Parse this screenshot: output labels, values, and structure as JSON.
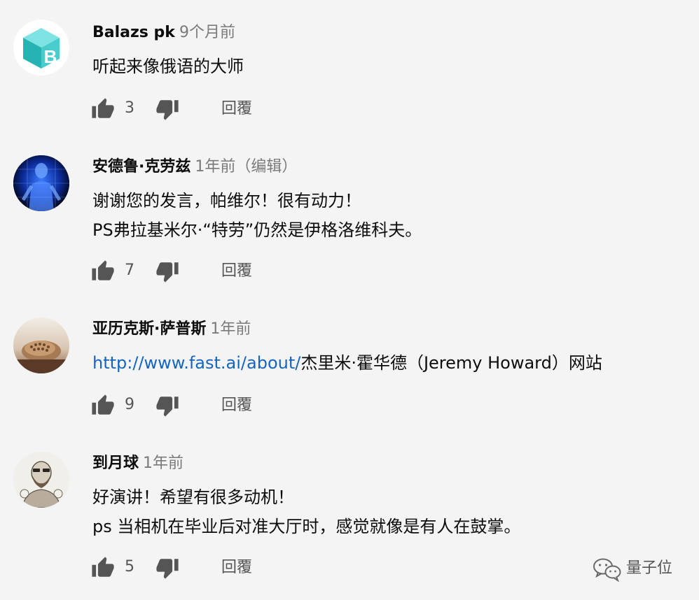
{
  "comments": [
    {
      "author": "Balazs pk",
      "time": "9个月前",
      "edited": "",
      "lines": [
        "听起来像俄语的大师"
      ],
      "likes": "3",
      "reply": "回覆",
      "avatar_icon": "letter-b-cube-avatar",
      "avatar_letter": "B"
    },
    {
      "author": "安德鲁·克劳兹",
      "time": "1年前",
      "edited": "（编辑）",
      "lines": [
        "谢谢您的发言，帕维尔！很有动力！",
        "PS弗拉基米尔·“特劳”仍然是伊格洛维科夫。"
      ],
      "likes": "7",
      "reply": "回覆",
      "avatar_icon": "blue-figure-avatar"
    },
    {
      "author": "亚历克斯·萨普斯",
      "time": "1年前",
      "edited": "",
      "link": "http://www.fast.ai/about/",
      "link_suffix": "杰里米·霍华德（Jeremy Howard）网站",
      "likes": "9",
      "reply": "回覆",
      "avatar_icon": "hedgehog-photo-avatar"
    },
    {
      "author": "到月球",
      "time": "1年前",
      "edited": "",
      "lines": [
        "好演讲！希望有很多动机！",
        "ps 当相机在毕业后对准大厅时，感觉就像是有人在鼓掌。"
      ],
      "likes": "5",
      "reply": "回覆",
      "avatar_icon": "bearded-man-sketch-avatar"
    }
  ],
  "watermark": {
    "text": "量子位",
    "icon": "wechat-icon"
  },
  "colors": {
    "background": "#f4f4f4",
    "link": "#1565c0",
    "meta": "#7a7a7a",
    "action": "#555555"
  }
}
